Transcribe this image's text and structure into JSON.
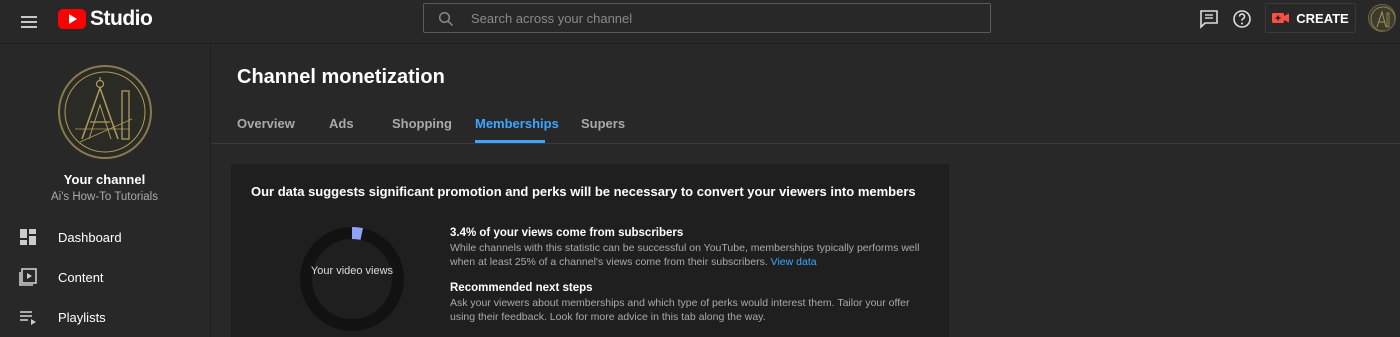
{
  "header": {
    "app_name": "Studio",
    "search_placeholder": "Search across your channel",
    "create_label": "CREATE",
    "icons": [
      "menu-icon",
      "youtube-logo-icon",
      "search-icon",
      "feedback-icon",
      "help-icon",
      "camera-icon"
    ],
    "colors": {
      "brand_red": "#ff0000",
      "accent_blue": "#3ea6ff"
    }
  },
  "sidebar": {
    "your_channel": "Your channel",
    "channel_name": "Ai's How-To Tutorials",
    "items": [
      {
        "label": "Dashboard",
        "icon": "dashboard-icon"
      },
      {
        "label": "Content",
        "icon": "content-icon"
      },
      {
        "label": "Playlists",
        "icon": "playlists-icon"
      }
    ]
  },
  "main": {
    "title": "Channel monetization",
    "tabs": [
      {
        "label": "Overview",
        "active": false
      },
      {
        "label": "Ads",
        "active": false
      },
      {
        "label": "Shopping",
        "active": false
      },
      {
        "label": "Memberships",
        "active": true
      },
      {
        "label": "Supers",
        "active": false
      }
    ],
    "card": {
      "title": "Our data suggests significant promotion and perks will be necessary to convert your viewers into members",
      "donut_label": "Your video views",
      "subscriber_share": 0.034,
      "stat_title": "3.4% of your views come from subscribers",
      "stat_desc": "While channels with this statistic can be successful on YouTube, memberships typically performs well when at least 25% of a channel's views come from their subscribers.",
      "stat_link": "View data",
      "steps_title": "Recommended next steps",
      "steps_desc": "Ask your viewers about memberships and which type of perks would interest them. Tailor your offer using their feedback. Look for more advice in this tab along the way."
    }
  }
}
